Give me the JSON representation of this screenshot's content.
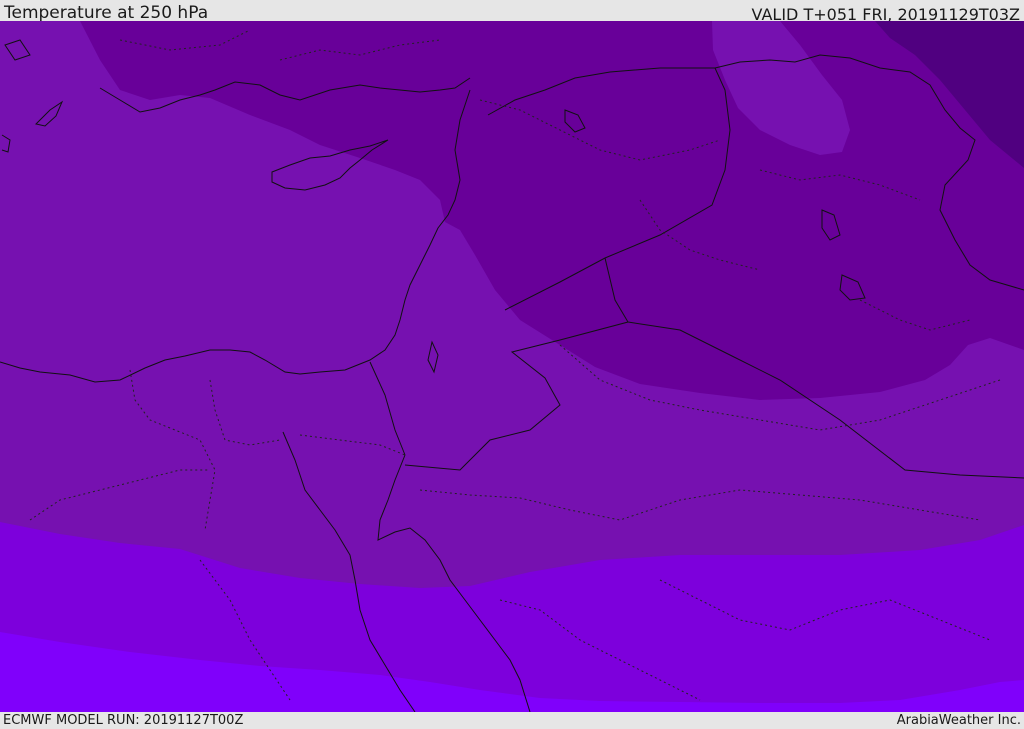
{
  "header": {
    "title": "Temperature at 250 hPa",
    "valid": "VALID T+051 FRI, 20191129T03Z"
  },
  "footer": {
    "model_run": "ECMWF MODEL RUN: 20191127T00Z",
    "credit": "ArabiaWeather Inc."
  },
  "colors": {
    "band_darkest": "#500080",
    "band_dark": "#680099",
    "band_mid": "#7611b0",
    "band_bright": "#7d00dc",
    "band_brightest": "#8000fb",
    "outline": "#111111"
  }
}
